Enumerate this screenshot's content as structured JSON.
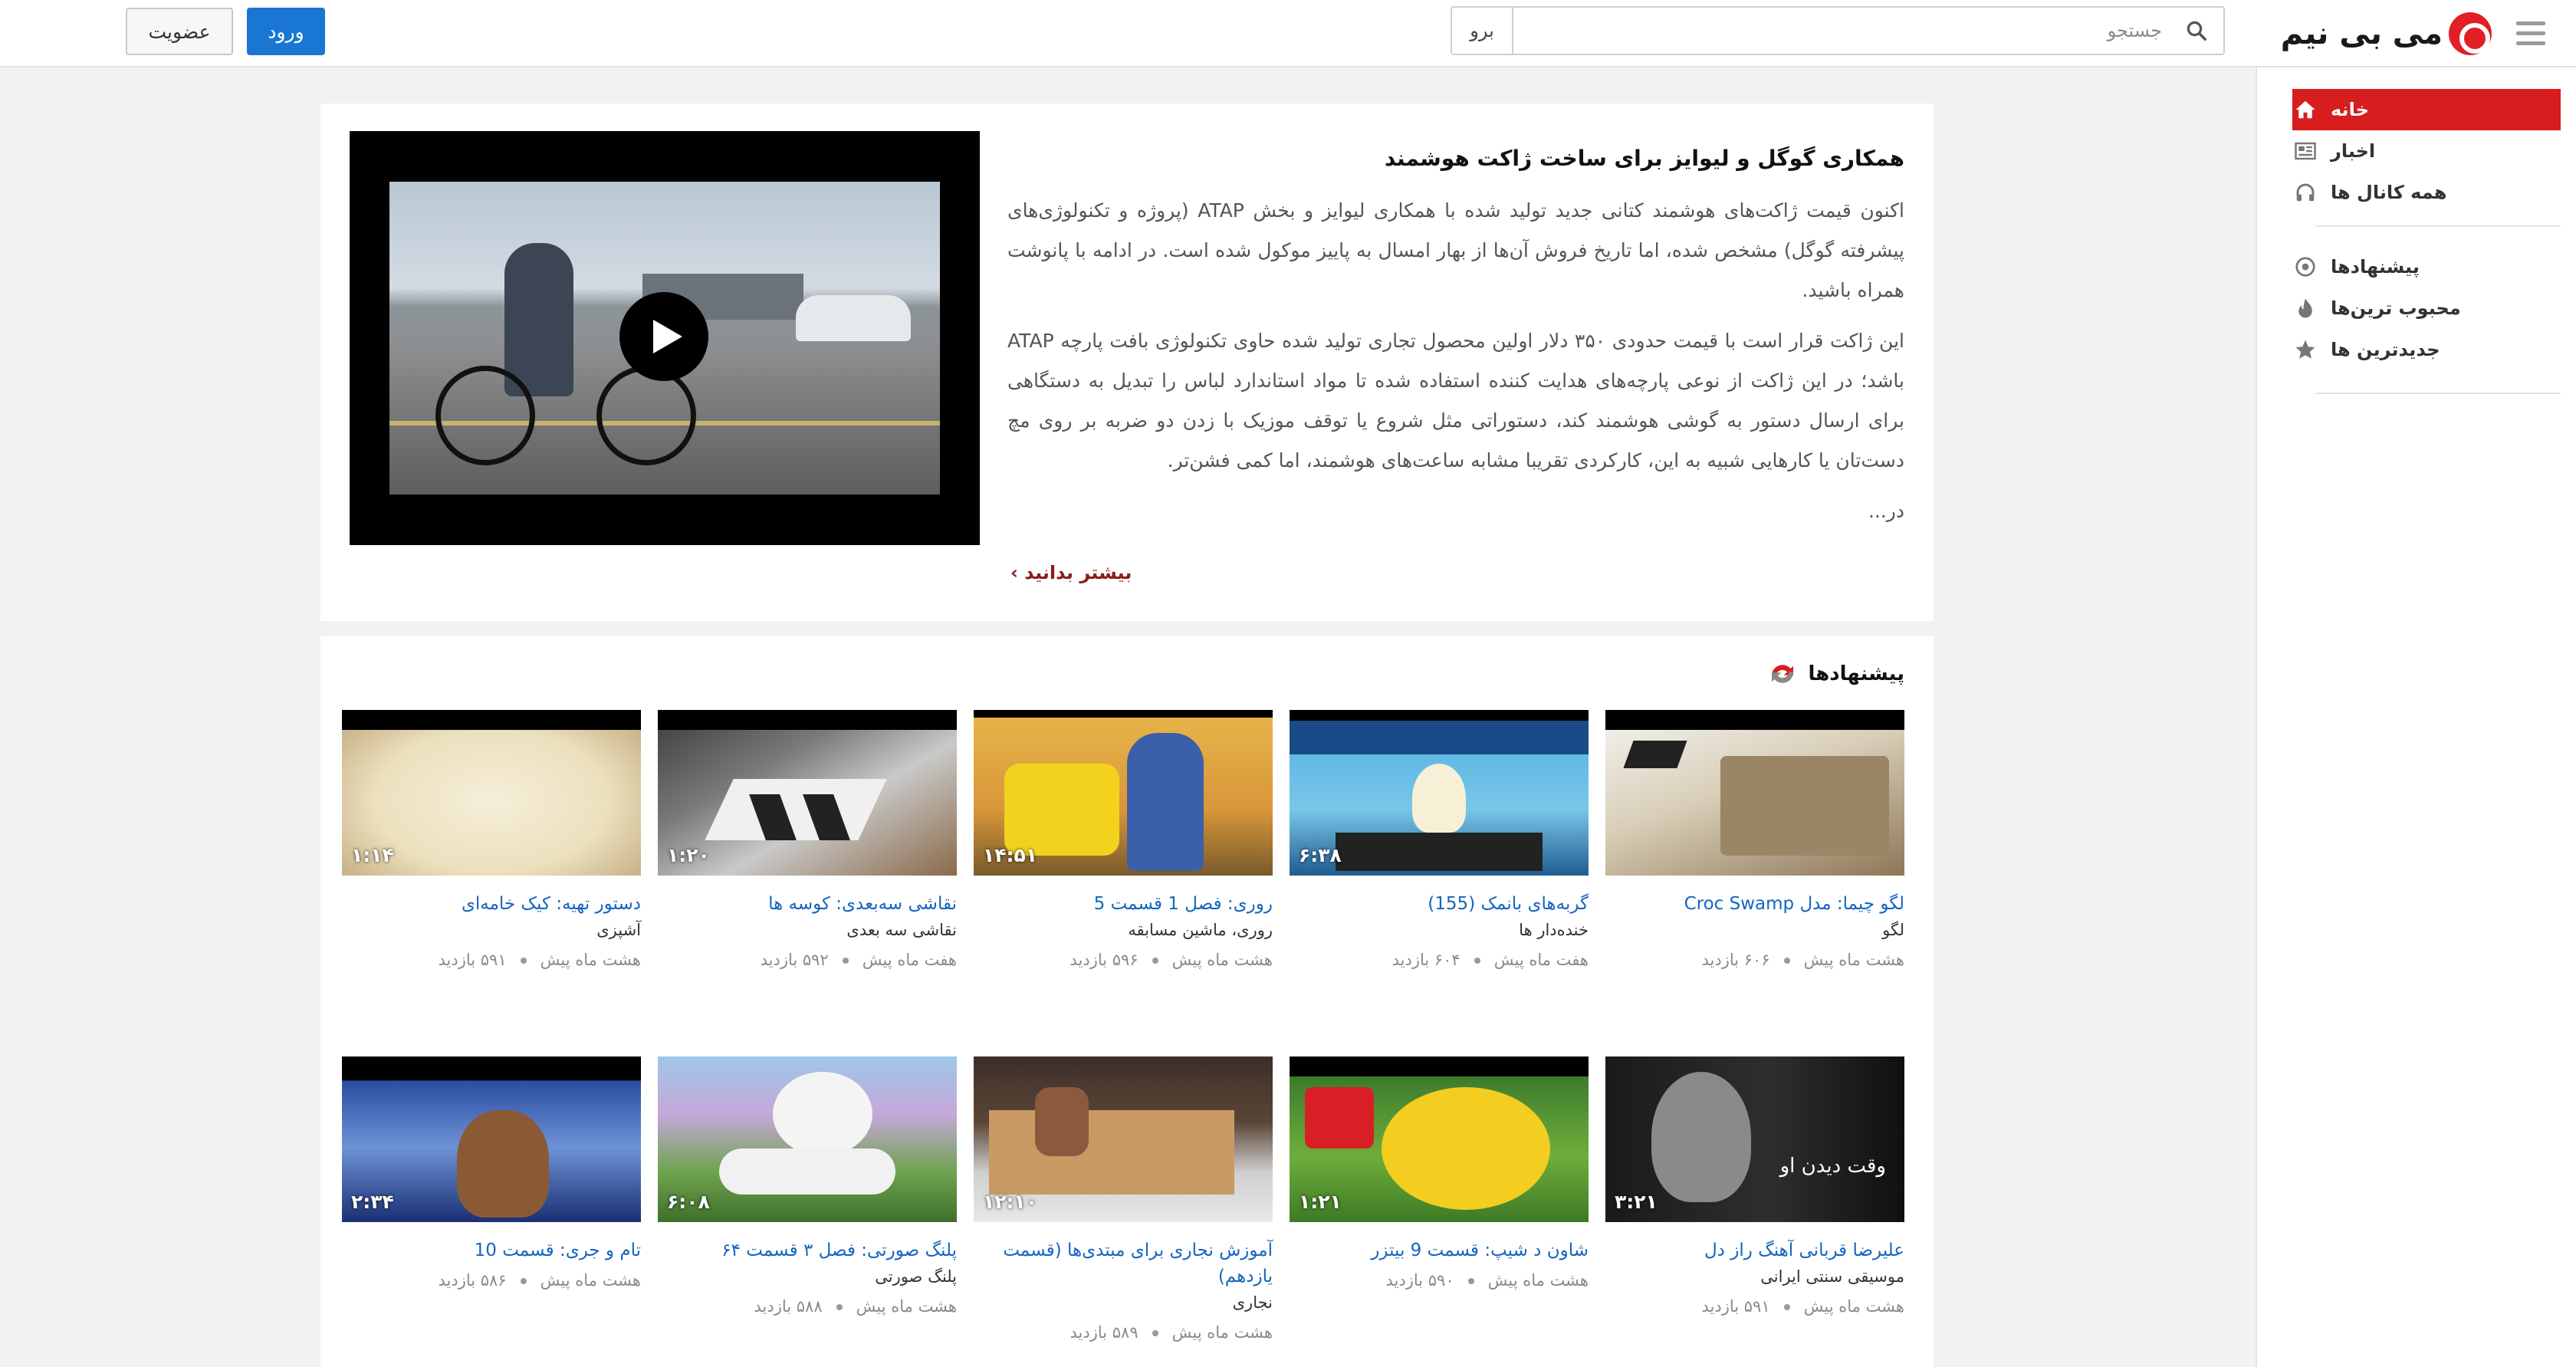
{
  "header": {
    "logo_text": "می بی نیم",
    "search_placeholder": "جستجو",
    "search_button": "برو",
    "login_label": "ورود",
    "register_label": "عضویت"
  },
  "sidebar": {
    "items": [
      {
        "label": "خانه",
        "icon": "home-icon"
      },
      {
        "label": "اخبار",
        "icon": "news-icon"
      },
      {
        "label": "همه کانال ها",
        "icon": "headphones-icon"
      },
      {
        "label": "پیشنهادها",
        "icon": "target-icon"
      },
      {
        "label": "محبوب ترین‌ها",
        "icon": "fire-icon"
      },
      {
        "label": "جدیدترین ها",
        "icon": "star-icon"
      }
    ]
  },
  "featured": {
    "title": "همکاری گوگل و لیوایز برای ساخت ژاکت هوشمند",
    "paragraph1": "اکنون قیمت ژاکت‌های هوشمند کتانی جدید تولید شده با همکاری لیوایز و بخش ATAP (پروژه و تکنولوژی‌های پیشرفته گوگل) مشخص شده، اما تاریخ فروش آن‌ها از بهار امسال به پاییز موکول شده است. در ادامه با پانوشت همراه باشید.",
    "paragraph2": "این ژاکت قرار است با قیمت حدودی ۳۵۰ دلار اولین محصول تجاری تولید شده حاوی تکنولوژی بافت پارچه ATAP باشد؛ در این ژاکت از نوعی پارچه‌های هدایت کننده استفاده شده تا مواد استاندارد لباس را تبدیل به دستگاهی برای ارسال دستور به گوشی هوشمند کند، دستوراتی مثل شروع یا توقف موزیک با زدن دو ضربه بر روی مچ دست‌تان یا کارهایی شبیه به این، کارکردی تقریبا مشابه ساعت‌های هوشمند، اما کمی فشن‌تر.",
    "paragraph3": "در...",
    "more_link": "بیشتر بدانید ›"
  },
  "suggestions": {
    "heading": "پیشنهادها",
    "videos": [
      {
        "title": "لگو چیما: مدل Croc Swamp",
        "channel": "لگو",
        "age": "هشت ماه پیش",
        "views": "۶۰۶ بازدید",
        "duration": ""
      },
      {
        "title": "گربه‌های بانمک (155)",
        "channel": "خنده‌دار ها",
        "age": "هفت ماه پیش",
        "views": "۶۰۴ بازدید",
        "duration": "۶:۳۸"
      },
      {
        "title": "روری: فصل 1 قسمت 5",
        "channel": "روری، ماشین مسابقه",
        "age": "هشت ماه پیش",
        "views": "۵۹۶ بازدید",
        "duration": "۱۴:۵۱"
      },
      {
        "title": "نقاشی سه‌بعدی: کوسه ها",
        "channel": "نقاشی سه بعدی",
        "age": "هفت ماه پیش",
        "views": "۵۹۲ بازدید",
        "duration": "۱:۲۰"
      },
      {
        "title": "دستور تهیه: کیک خامه‌ای",
        "channel": "آشپزی",
        "age": "هشت ماه پیش",
        "views": "۵۹۱ بازدید",
        "duration": "۱:۱۴"
      },
      {
        "title": "علیرضا قربانی آهنگ راز دل",
        "channel": "موسیقی سنتی ایرانی",
        "age": "هشت ماه پیش",
        "views": "۵۹۱ بازدید",
        "duration": "۳:۲۱",
        "overlay": "وقت دیدن او"
      },
      {
        "title": "شاون د شیپ: قسمت 9 بیتزر",
        "channel": "",
        "age": "هشت ماه پیش",
        "views": "۵۹۰ بازدید",
        "duration": "۱:۲۱"
      },
      {
        "title": "آموزش نجاری برای مبتدی‌ها (قسمت یازدهم)",
        "channel": "نجاری",
        "age": "هشت ماه پیش",
        "views": "۵۸۹ بازدید",
        "duration": "۱۲:۱۰"
      },
      {
        "title": "پلنگ صورتی: فصل ۳ قسمت ۶۴",
        "channel": "پلنگ صورتی",
        "age": "هشت ماه پیش",
        "views": "۵۸۸ بازدید",
        "duration": "۶:۰۸"
      },
      {
        "title": "تام و جری: قسمت 10",
        "channel": "",
        "age": "هشت ماه پیش",
        "views": "۵۸۶ بازدید",
        "duration": "۲:۳۴"
      }
    ]
  },
  "colors": {
    "accent_red": "#d71d1d",
    "primary_blue": "#1976d2",
    "link_blue": "#1565c0"
  }
}
